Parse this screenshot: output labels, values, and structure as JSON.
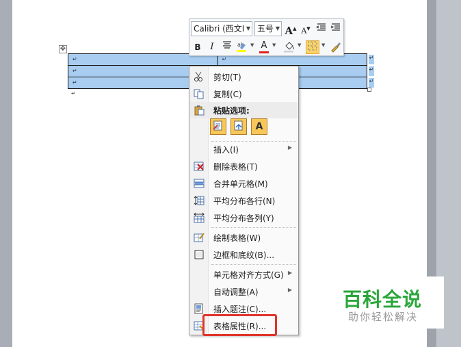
{
  "mini_toolbar": {
    "font_name": "Calibri (西文I",
    "font_size": "五号",
    "grow_font_label": "A",
    "shrink_font_label": "A",
    "bold_label": "B",
    "italic_label": "I",
    "font_color_label": "A"
  },
  "table": {
    "cell_mark": "↵"
  },
  "context_menu": {
    "items": [
      {
        "label": "剪切(T)",
        "icon": "scissors-icon"
      },
      {
        "label": "复制(C)",
        "icon": "copy-icon"
      },
      {
        "label": "粘贴选项:",
        "icon": "paste-icon"
      },
      {
        "label": "插入(I)",
        "icon": "",
        "submenu": true
      },
      {
        "label": "删除表格(T)",
        "icon": "delete-table-icon"
      },
      {
        "label": "合并单元格(M)",
        "icon": "merge-cells-icon"
      },
      {
        "label": "平均分布各行(N)",
        "icon": "distribute-rows-icon"
      },
      {
        "label": "平均分布各列(Y)",
        "icon": "distribute-columns-icon"
      },
      {
        "label": "绘制表格(W)",
        "icon": "draw-table-icon"
      },
      {
        "label": "边框和底纹(B)...",
        "icon": "borders-icon"
      },
      {
        "label": "单元格对齐方式(G)",
        "icon": "",
        "submenu": true
      },
      {
        "label": "自动调整(A)",
        "icon": "",
        "submenu": true
      },
      {
        "label": "插入题注(C)...",
        "icon": "caption-icon"
      },
      {
        "label": "表格属性(R)...",
        "icon": "table-properties-icon"
      }
    ],
    "paste_option_text_label": "A"
  },
  "watermark": {
    "title": "百科全说",
    "subtitle": "助你轻松解决"
  },
  "colors": {
    "selection": "#a8cdf1",
    "highlight_border": "#e0332c",
    "watermark_green": "#2aa63a"
  }
}
